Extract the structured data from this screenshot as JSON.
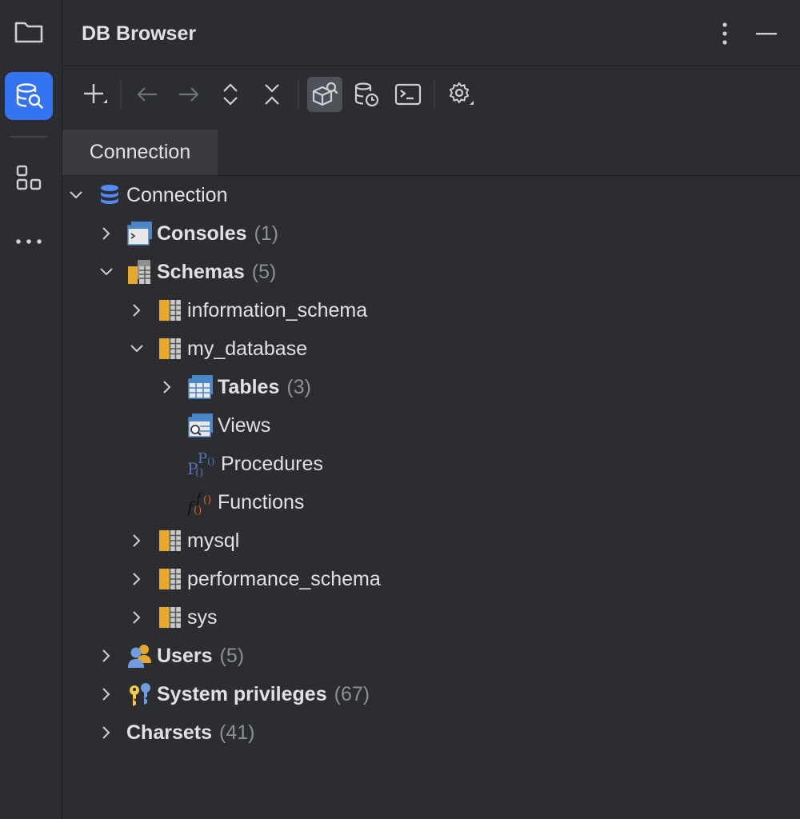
{
  "window": {
    "title": "DB Browser"
  },
  "toolbar": {
    "buttons": [
      {
        "name": "add",
        "icon": "plus-icon"
      },
      {
        "name": "back",
        "icon": "arrow-left-icon"
      },
      {
        "name": "forward",
        "icon": "arrow-right-icon"
      },
      {
        "name": "expand-all",
        "icon": "expand-icon"
      },
      {
        "name": "collapse-all",
        "icon": "collapse-icon"
      },
      {
        "name": "object-filter",
        "icon": "cube-search-icon",
        "selected": true
      },
      {
        "name": "history",
        "icon": "database-clock-icon"
      },
      {
        "name": "console",
        "icon": "terminal-icon"
      },
      {
        "name": "settings",
        "icon": "gear-icon"
      }
    ]
  },
  "tabs": [
    {
      "label": "Connection",
      "active": true
    }
  ],
  "tree": {
    "root": {
      "label": "Connection"
    },
    "consoles": {
      "label": "Consoles",
      "count": "(1)"
    },
    "schemas": {
      "label": "Schemas",
      "count": "(5)"
    },
    "information_schema": {
      "label": "information_schema"
    },
    "my_database": {
      "label": "my_database"
    },
    "tables": {
      "label": "Tables",
      "count": "(3)"
    },
    "views": {
      "label": "Views"
    },
    "procedures": {
      "label": "Procedures"
    },
    "functions": {
      "label": "Functions"
    },
    "mysql": {
      "label": "mysql"
    },
    "performance_schema": {
      "label": "performance_schema"
    },
    "sys": {
      "label": "sys"
    },
    "users": {
      "label": "Users",
      "count": "(5)"
    },
    "system_privileges": {
      "label": "System privileges",
      "count": "(67)"
    },
    "charsets": {
      "label": "Charsets",
      "count": "(41)"
    }
  },
  "colors": {
    "background": "#2b2d30",
    "accent": "#3574f0",
    "text": "#dfe1e5",
    "muted": "#8c8f94",
    "schema_orange": "#e6a72a"
  }
}
